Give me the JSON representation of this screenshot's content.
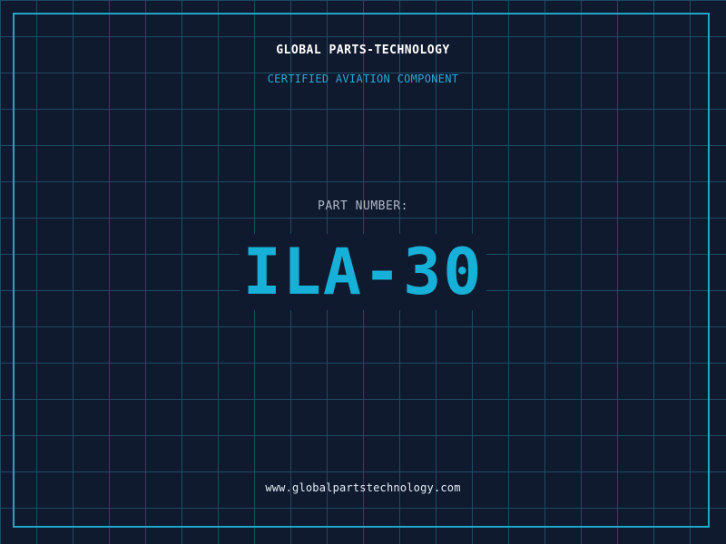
{
  "header": {
    "company": "GLOBAL PARTS-TECHNOLOGY",
    "subtitle": "CERTIFIED AVIATION COMPONENT"
  },
  "part": {
    "label": "PART NUMBER:",
    "number": "ILA-30"
  },
  "footer": {
    "url": "www.globalpartstechnology.com"
  },
  "colors": {
    "background": "#101a2e",
    "grid": "#1d4a66",
    "accent": "#16b0d8",
    "frame": "#1fa6c8"
  }
}
